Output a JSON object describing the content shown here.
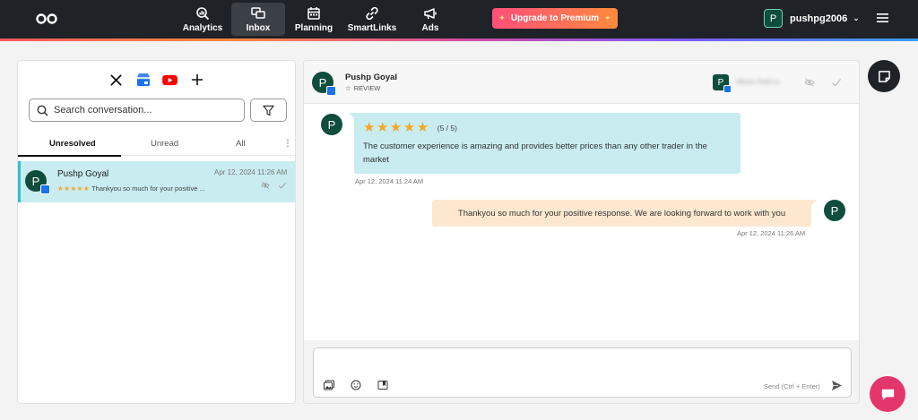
{
  "nav": {
    "items": [
      {
        "label": "Analytics",
        "icon": "analytics-icon"
      },
      {
        "label": "Inbox",
        "icon": "inbox-icon",
        "active": true
      },
      {
        "label": "Planning",
        "icon": "calendar-icon"
      },
      {
        "label": "SmartLinks",
        "icon": "link-icon"
      },
      {
        "label": "Ads",
        "icon": "megaphone-icon"
      }
    ],
    "upgrade_label": "Upgrade to Premium",
    "user": {
      "initial": "P",
      "name": "pushpg2006"
    }
  },
  "sidebar": {
    "channels": [
      "x-icon",
      "google-business-icon",
      "youtube-icon",
      "plus-icon"
    ],
    "search_placeholder": "Search conversation...",
    "tabs": [
      "Unresolved",
      "Unread",
      "All"
    ],
    "active_tab": "Unresolved",
    "conversations": [
      {
        "initial": "P",
        "name": "Pushp Goyal",
        "time": "Apr 12, 2024 11:26 AM",
        "stars": "★★★★★",
        "snippet": "Thankyou so much for your positive ..."
      }
    ]
  },
  "chat": {
    "header": {
      "initial": "P",
      "name": "Pushp Goyal",
      "type": "REVIEW",
      "account_initial": "P",
      "account_name": "Mbaw Ra0Ca"
    },
    "messages": [
      {
        "direction": "in",
        "initial": "P",
        "stars": "★★★★★",
        "rating": "(5 / 5)",
        "text": "The customer experience is amazing and provides better prices than any other trader in the market",
        "time": "Apr 12, 2024 11:24 AM"
      },
      {
        "direction": "out",
        "initial": "P",
        "text": "Thankyou so much for your positive response. We are looking forward to work with you",
        "time": "Apr 12, 2024 11:26 AM"
      }
    ],
    "composer": {
      "placeholder": "",
      "send_hint": "Send (Ctrl + Enter)"
    }
  },
  "colors": {
    "topbar": "#1f2227",
    "accent_teal": "#c8ecf0",
    "reply_bubble": "#fde8cf",
    "avatar": "#0f4d3c",
    "chat_fab": "#e3366d"
  }
}
